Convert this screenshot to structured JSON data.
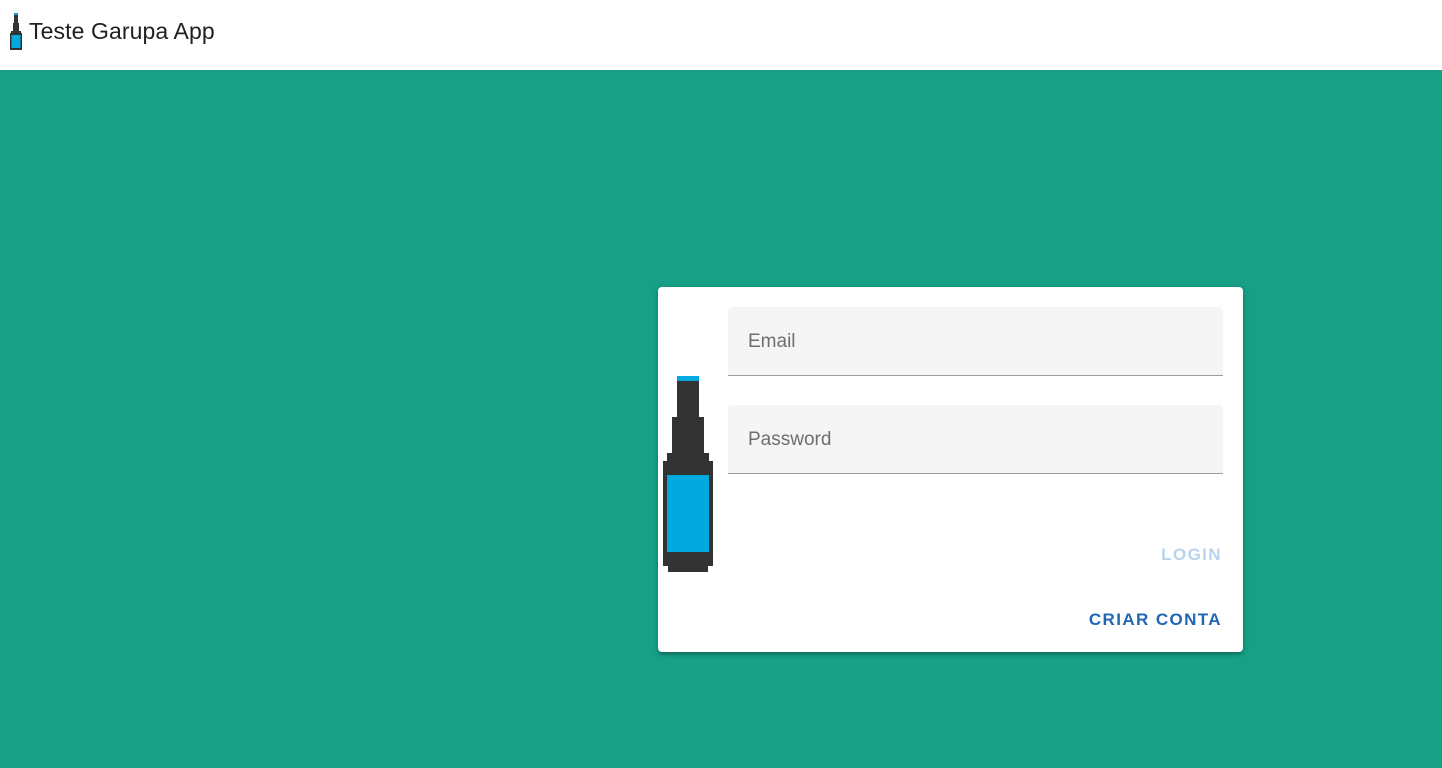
{
  "app": {
    "title": "Teste Garupa App"
  },
  "colors": {
    "background": "#17a086",
    "bottle_dark": "#333333",
    "bottle_label": "#02a9df",
    "primary": "#1f67b5",
    "disabled": "#b8d3ed"
  },
  "login_form": {
    "email": {
      "placeholder": "Email",
      "value": ""
    },
    "password": {
      "placeholder": "Password",
      "value": ""
    },
    "login_label": "LOGIN",
    "login_disabled": true,
    "create_account_label": "CRIAR CONTA"
  },
  "icons": {
    "app_logo": "bottle-icon",
    "card_logo": "bottle-icon"
  }
}
